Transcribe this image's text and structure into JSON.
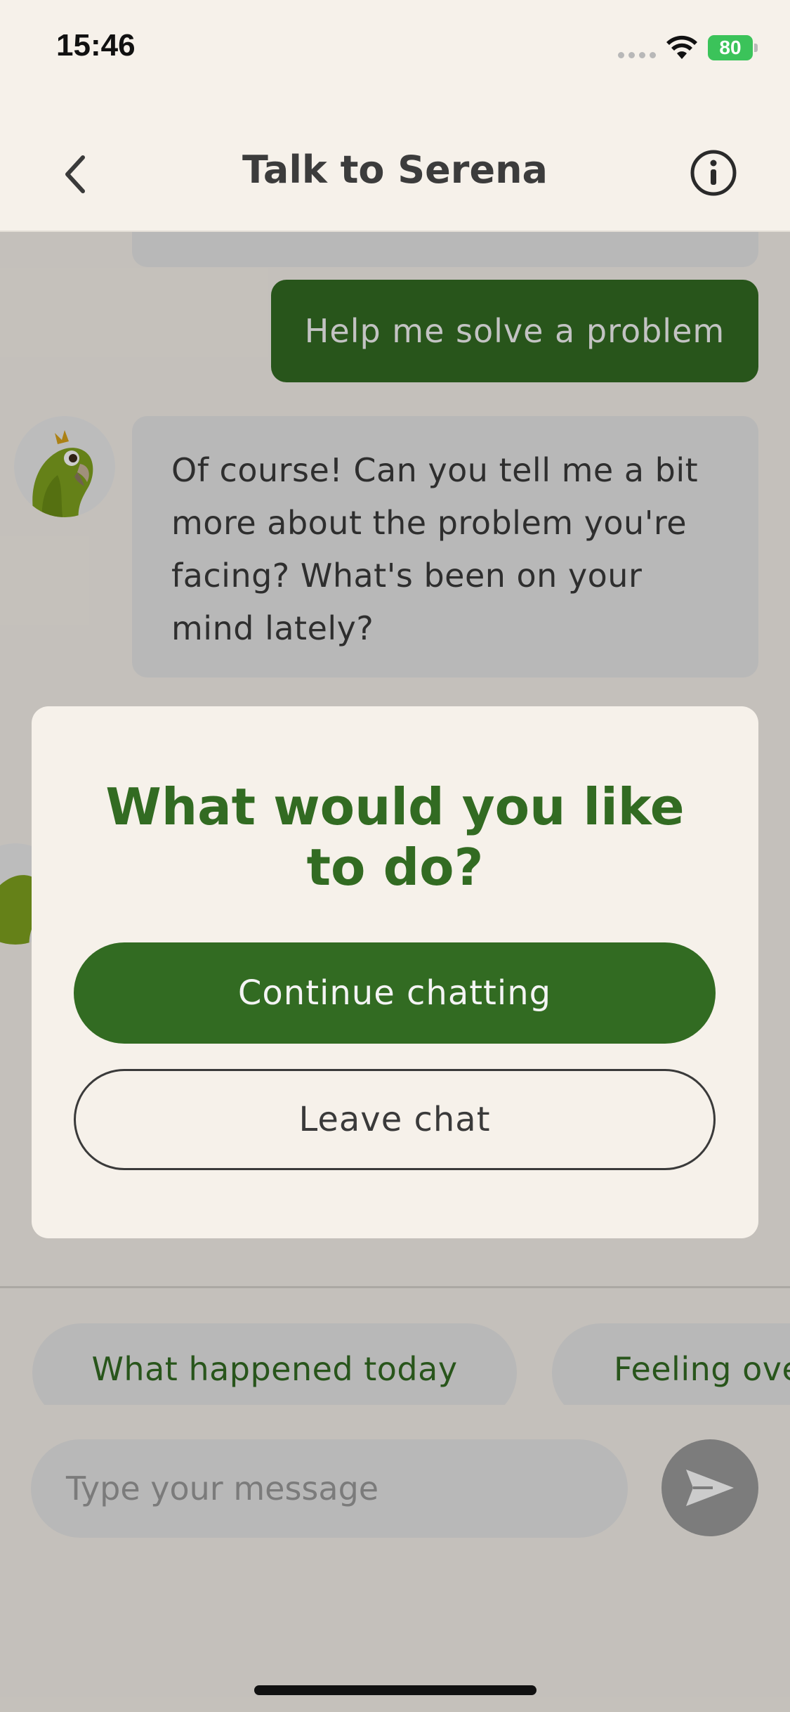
{
  "status_bar": {
    "time": "15:46",
    "battery": "80"
  },
  "header": {
    "title": "Talk to Serena",
    "back_icon": "chevron-left-icon",
    "info_icon": "info-circle-icon"
  },
  "chat": {
    "messages": [
      {
        "from": "user",
        "text": "Help me solve a problem"
      },
      {
        "from": "bot",
        "text": "Of course! Can you tell me a bit more about the problem you're facing? What's been on your mind lately?"
      }
    ]
  },
  "suggestions": [
    "What happened today",
    "Feeling ove"
  ],
  "composer": {
    "placeholder": "Type your message",
    "send_icon": "send-icon"
  },
  "modal": {
    "title": "What would you like to do?",
    "continue_label": "Continue chatting",
    "leave_label": "Leave chat"
  },
  "colors": {
    "primary_green": "#326b22",
    "background": "#f6f1ea",
    "bubble": "#e6e6e6"
  }
}
